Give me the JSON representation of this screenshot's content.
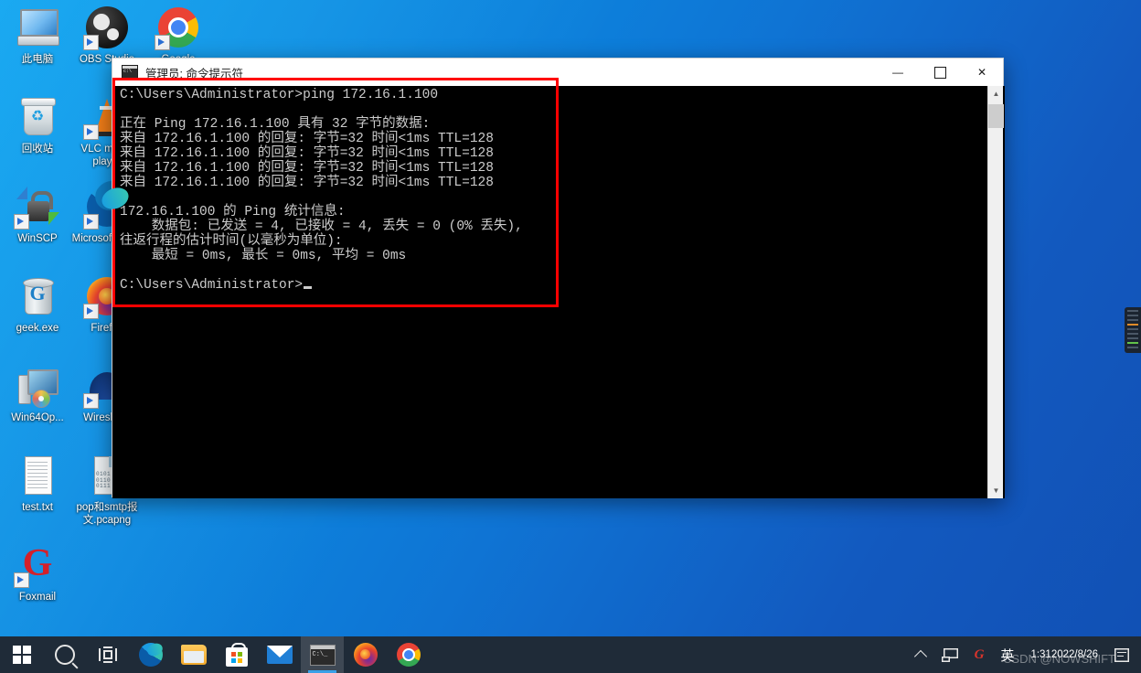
{
  "desktop": {
    "icons": [
      {
        "label": "此电脑",
        "icon": "this-pc-icon",
        "col": 0,
        "row": 0
      },
      {
        "label": "OBS Studio",
        "icon": "obs-studio-icon",
        "col": 1,
        "row": 0
      },
      {
        "label": "Google Chrome",
        "icon": "google-chrome-icon",
        "col": 2,
        "row": 0
      },
      {
        "label": "回收站",
        "icon": "recycle-bin-icon",
        "col": 0,
        "row": 1
      },
      {
        "label": "VLC media player",
        "icon": "vlc-cone-icon",
        "col": 1,
        "row": 1
      },
      {
        "label": "WinSCP",
        "icon": "winscp-padlock-icon",
        "col": 0,
        "row": 2
      },
      {
        "label": "Microsoft Edge",
        "icon": "microsoft-edge-icon",
        "col": 1,
        "row": 2
      },
      {
        "label": "geek.exe",
        "icon": "geek-uninstaller-icon",
        "col": 0,
        "row": 3
      },
      {
        "label": "Firefox",
        "icon": "firefox-icon",
        "col": 1,
        "row": 3
      },
      {
        "label": "Win64Op...",
        "icon": "win64-openssl-icon",
        "col": 0,
        "row": 4
      },
      {
        "label": "Wireshark",
        "icon": "wireshark-icon",
        "col": 1,
        "row": 4
      },
      {
        "label": "test.txt",
        "icon": "text-file-icon",
        "col": 0,
        "row": 5
      },
      {
        "label": "pop和smtp报文.pcapng",
        "icon": "pcapng-file-icon",
        "col": 1,
        "row": 5
      },
      {
        "label": "Foxmail",
        "icon": "foxmail-icon",
        "col": 0,
        "row": 6
      }
    ]
  },
  "cmd_window": {
    "title": "管理员: 命令提示符",
    "title_icon": "console-icon",
    "controls": {
      "minimize": "—",
      "maximize": "☐",
      "close": "✕"
    },
    "scrollbar": {
      "up_arrow": "▲",
      "down_arrow": "▼"
    },
    "console_lines": [
      "C:\\Users\\Administrator>ping 172.16.1.100",
      "",
      "正在 Ping 172.16.1.100 具有 32 字节的数据:",
      "来自 172.16.1.100 的回复: 字节=32 时间<1ms TTL=128",
      "来自 172.16.1.100 的回复: 字节=32 时间<1ms TTL=128",
      "来自 172.16.1.100 的回复: 字节=32 时间<1ms TTL=128",
      "来自 172.16.1.100 的回复: 字节=32 时间<1ms TTL=128",
      "",
      "172.16.1.100 的 Ping 统计信息:",
      "    数据包: 已发送 = 4, 已接收 = 4, 丢失 = 0 (0% 丢失),",
      "往返行程的估计时间(以毫秒为单位):",
      "    最短 = 0ms, 最长 = 0ms, 平均 = 0ms",
      "",
      "C:\\Users\\Administrator>"
    ],
    "prompt": "C:\\Users\\Administrator>",
    "command": "ping 172.16.1.100",
    "target_ip": "172.16.1.100",
    "packet_bytes": "32",
    "ttl": "128",
    "sent": "4",
    "received": "4",
    "lost": "0",
    "loss_percent": "0%",
    "min_ms": "0ms",
    "max_ms": "0ms",
    "avg_ms": "0ms"
  },
  "annotation": {
    "shape": "rectangle",
    "color": "#ff0000"
  },
  "taskbar": {
    "items": [
      {
        "name": "start-button",
        "label": "开始"
      },
      {
        "name": "search-button",
        "label": "搜索"
      },
      {
        "name": "task-view-button",
        "label": "任务视图"
      },
      {
        "name": "edge-button",
        "label": "Microsoft Edge"
      },
      {
        "name": "file-explorer-button",
        "label": "文件资源管理器"
      },
      {
        "name": "microsoft-store-button",
        "label": "Microsoft Store"
      },
      {
        "name": "mail-button",
        "label": "邮件"
      },
      {
        "name": "command-prompt-button",
        "label": "命令提示符",
        "active": true
      },
      {
        "name": "firefox-button",
        "label": "Firefox"
      },
      {
        "name": "chrome-button",
        "label": "Google Chrome"
      }
    ],
    "tray": {
      "overflow_label": "显示隐藏的图标",
      "network_label": "网络",
      "sogou_label": "G",
      "ime_label": "英",
      "time": "1:31",
      "date": "2022/8/26",
      "notifications_label": "通知"
    }
  },
  "side_widget": {
    "name": "docked-panel"
  },
  "watermark": {
    "text": "CSDN @NOWSHIFT"
  },
  "colors": {
    "desktop_start": "#00a0f0",
    "desktop_end": "#1150b4",
    "taskbar": "#1f2b38",
    "console_bg": "#000000",
    "console_fg": "#cccccc",
    "annotation": "#ff0000",
    "accent": "#3aa0e8"
  }
}
